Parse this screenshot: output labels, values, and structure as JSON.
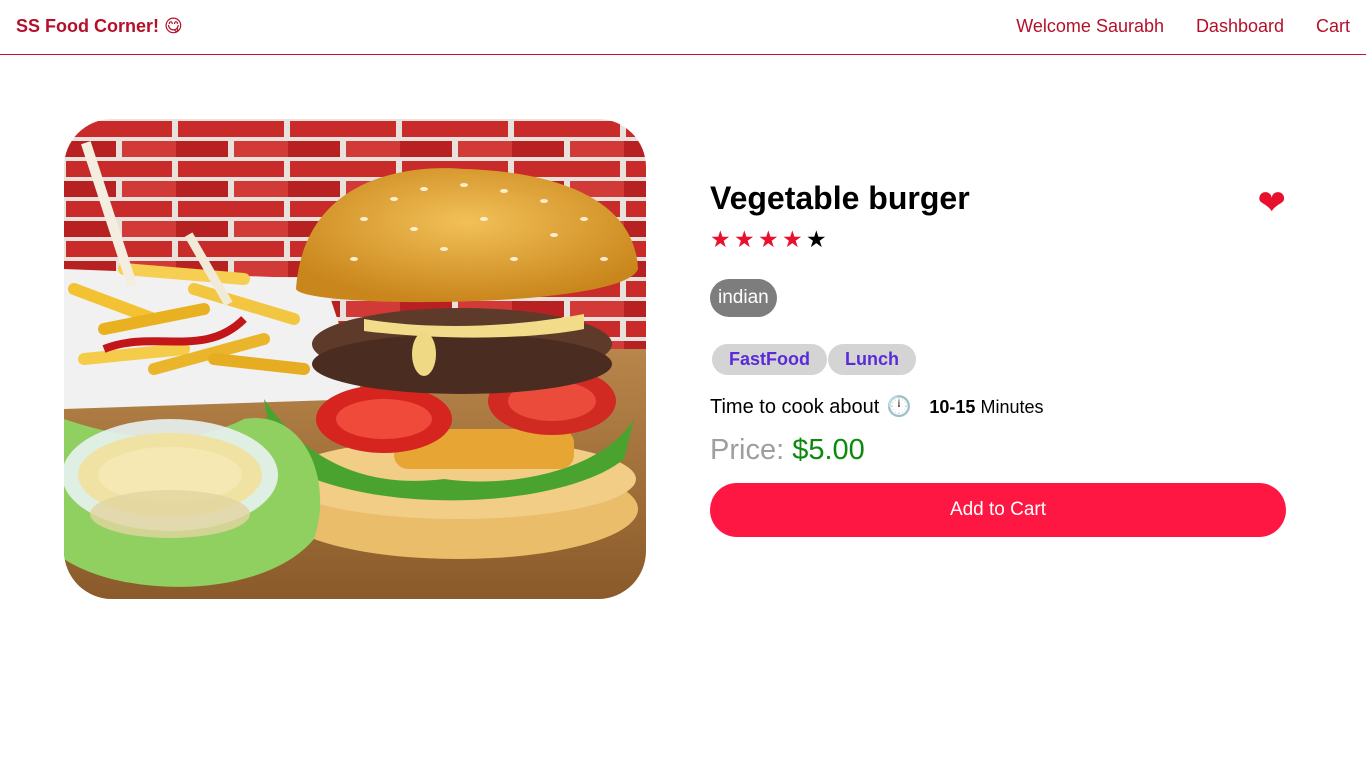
{
  "header": {
    "logo_text": "SS Food Corner!",
    "logo_emoji": "😋",
    "nav": {
      "welcome": "Welcome Saurabh",
      "dashboard": "Dashboard",
      "cart": "Cart"
    }
  },
  "food": {
    "image_alt": "burger-photo",
    "name": "Vegetable burger",
    "favorite_icon": "heart-icon",
    "favorite_glyph": "❤",
    "rating": {
      "value": 4,
      "max": 5,
      "star_glyph": "★",
      "filled_color": "#e8102f",
      "empty_color": "#000000"
    },
    "origin": "indian",
    "tags": [
      "FastFood",
      "Lunch"
    ],
    "cook_time": {
      "label": "Time to cook about",
      "clock_glyph": "🕛",
      "range": "10-15",
      "unit": "Minutes"
    },
    "price": {
      "label": "Price:",
      "value": "$5.00"
    },
    "add_to_cart_label": "Add to Cart"
  },
  "colors": {
    "brand": "#b5102a",
    "accent": "#ff1744",
    "price": "#0d8a0d",
    "tag_text": "#5a2bd8"
  }
}
